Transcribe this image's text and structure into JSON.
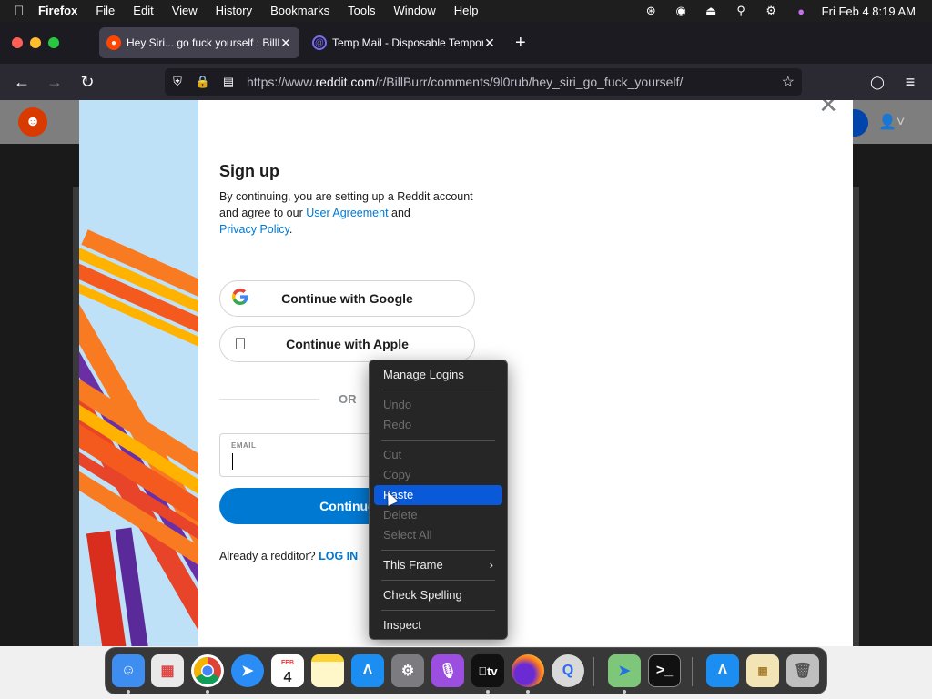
{
  "menubar": {
    "apple_icon": "apple-icon",
    "app_name": "Firefox",
    "items": [
      "File",
      "Edit",
      "View",
      "History",
      "Bookmarks",
      "Tools",
      "Window",
      "Help"
    ],
    "clock": "Fri Feb 4  8:19 AM"
  },
  "tabs": [
    {
      "title": "Hey Siri... go fuck yourself : BillBurr",
      "favicon": "reddit-icon",
      "active": true
    },
    {
      "title": "Temp Mail - Disposable Temporary Email",
      "favicon": "at-icon",
      "active": false
    }
  ],
  "toolbar": {
    "url_prefix": "https://www.",
    "url_domain": "reddit.com",
    "url_path": "/r/BillBurr/comments/9l0rub/hey_siri_go_fuck_yourself/"
  },
  "signup": {
    "title": "Sign up",
    "desc_part1": "By continuing, you are setting up a Reddit account and agree to our ",
    "user_agreement": "User Agreement",
    "desc_and": " and ",
    "privacy_policy": "Privacy Policy",
    "desc_end": ".",
    "google_label": "Continue with Google",
    "apple_label": "Continue with Apple",
    "or_label": "OR",
    "email_label": "EMAIL",
    "email_value": "",
    "continue_label": "Continue",
    "already_text": "Already a redditor? ",
    "login_link": "LOG IN"
  },
  "context_menu": {
    "manage_logins": "Manage Logins",
    "undo": "Undo",
    "redo": "Redo",
    "cut": "Cut",
    "copy": "Copy",
    "paste": "Paste",
    "delete": "Delete",
    "select_all": "Select All",
    "this_frame": "This Frame",
    "check_spelling": "Check Spelling",
    "inspect": "Inspect"
  },
  "dock": {
    "calendar_month": "FEB",
    "calendar_day": "4",
    "tv_label": "tv"
  },
  "colors": {
    "accent_blue": "#0079d3",
    "reddit_orange": "#ff4500",
    "menu_highlight": "#0a59d8"
  }
}
